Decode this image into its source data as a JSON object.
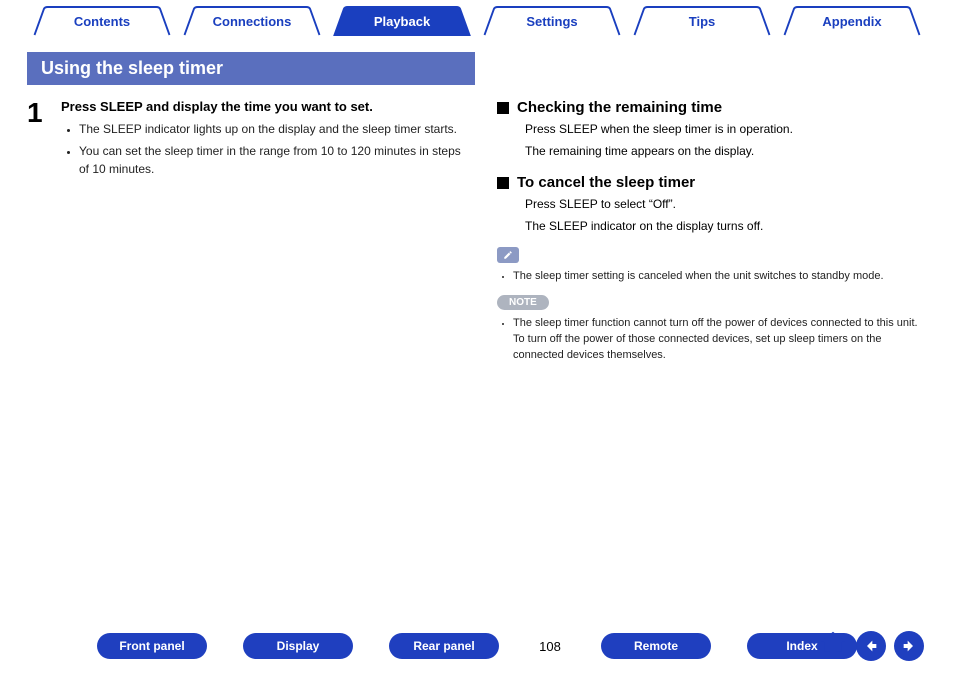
{
  "tabs": {
    "contents": "Contents",
    "connections": "Connections",
    "playback": "Playback",
    "settings": "Settings",
    "tips": "Tips",
    "appendix": "Appendix"
  },
  "section_title": "Using the sleep timer",
  "step1": {
    "num": "1",
    "head": "Press SLEEP and display the time you want to set.",
    "b1": "The SLEEP indicator lights up on the display and the sleep timer starts.",
    "b2": "You can set the sleep timer in the range from 10 to 120 minutes in steps of 10 minutes."
  },
  "right": {
    "check_h": "Checking the remaining time",
    "check_p1": "Press SLEEP when the sleep timer is in operation.",
    "check_p2": "The remaining time appears on the display.",
    "cancel_h": "To cancel the sleep timer",
    "cancel_p1": "Press SLEEP to select “Off”.",
    "cancel_p2": "The SLEEP indicator on the display turns off.",
    "tip": "The sleep timer setting is canceled when the unit switches to standby mode.",
    "note_label": "NOTE",
    "note": "The sleep timer function cannot turn off the power of devices connected to this unit. To turn off the power of those connected devices, set up sleep timers on the connected devices themselves."
  },
  "bottom": {
    "front_panel": "Front panel",
    "display": "Display",
    "rear_panel": "Rear panel",
    "page": "108",
    "remote": "Remote",
    "index": "Index"
  }
}
